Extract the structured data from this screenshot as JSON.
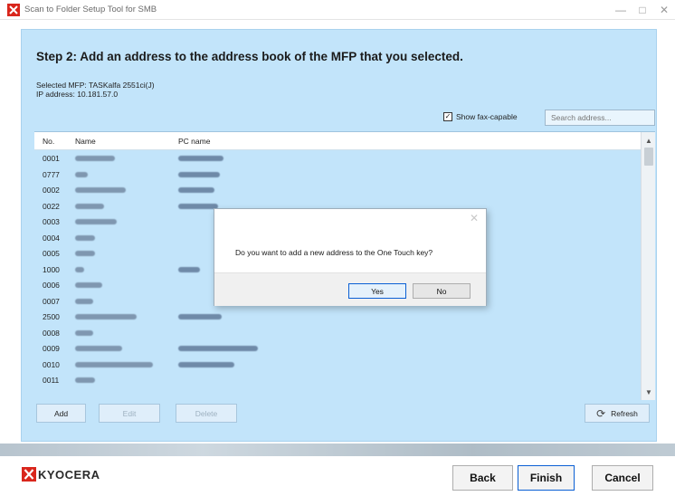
{
  "window": {
    "title": "Scan to Folder Setup Tool for SMB",
    "minimize_glyph": "—",
    "maximize_glyph": "□",
    "close_glyph": "✕",
    "app_icon": "kyocera-app-icon"
  },
  "main": {
    "step_title": "Step 2: Add an address to the address book of the MFP that you selected.",
    "selected_mfp": "Selected MFP: TASKalfa 2551ci(J)",
    "ip_address": "IP address: 10.181.57.0",
    "show_fax_label": "Show fax-capable",
    "show_fax_checked": true,
    "search_placeholder": "Search address...",
    "search_value": ""
  },
  "table": {
    "headers": {
      "no": "No.",
      "name": "Name",
      "pc_name": "PC name"
    },
    "rows": [
      {
        "no": "0001"
      },
      {
        "no": "0777"
      },
      {
        "no": "0002"
      },
      {
        "no": "0022"
      },
      {
        "no": "0003"
      },
      {
        "no": "0004"
      },
      {
        "no": "0005"
      },
      {
        "no": "1000"
      },
      {
        "no": "0006"
      },
      {
        "no": "0007"
      },
      {
        "no": "2500"
      },
      {
        "no": "0008"
      },
      {
        "no": "0009"
      },
      {
        "no": "0010"
      },
      {
        "no": "0011"
      }
    ],
    "scroll_up_glyph": "▲",
    "scroll_down_glyph": "▼"
  },
  "actions": {
    "add": "Add",
    "edit": "Edit",
    "delete": "Delete",
    "refresh": "Refresh",
    "refresh_icon": "refresh-icon"
  },
  "footer": {
    "logo_text": "KYOCERA",
    "back": "Back",
    "finish": "Finish",
    "cancel": "Cancel"
  },
  "dialog": {
    "message": "Do you want to add a new address to the One Touch key?",
    "yes": "Yes",
    "no": "No",
    "close_glyph": "✕"
  },
  "colors": {
    "panel": "#c2e4fa",
    "brand_red": "#d9261c",
    "focus_blue": "#0a5fd4"
  }
}
